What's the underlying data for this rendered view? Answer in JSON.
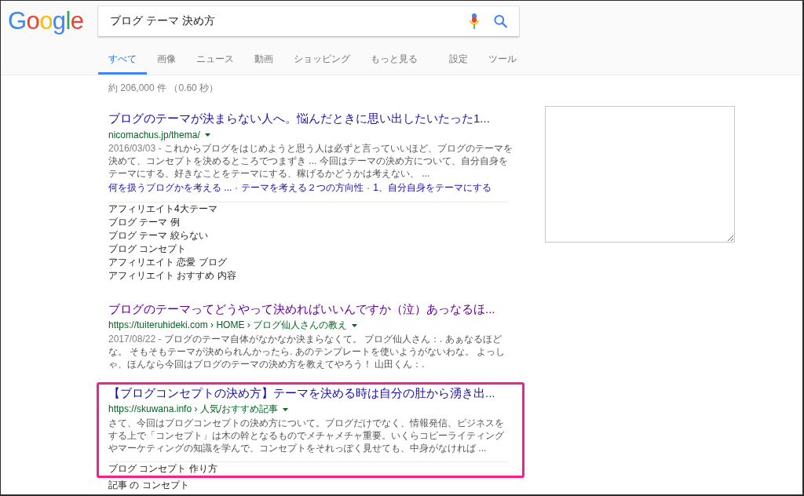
{
  "logo": "Google",
  "search": {
    "value": "ブログ テーマ 決め方"
  },
  "nav_tabs": [
    {
      "label": "すべて",
      "selected": true
    },
    {
      "label": "画像",
      "selected": false
    },
    {
      "label": "ニュース",
      "selected": false
    },
    {
      "label": "動画",
      "selected": false
    },
    {
      "label": "ショッピング",
      "selected": false
    },
    {
      "label": "もっと見る",
      "selected": false
    }
  ],
  "nav_tools": [
    {
      "label": "設定"
    },
    {
      "label": "ツール"
    }
  ],
  "result_stats": "約 206,000 件 （0.60 秒）",
  "results": [
    {
      "title": "ブログのテーマが決まらない人へ。悩んだときに思い出したいたった1...",
      "visited": false,
      "url": "nicomachus.jp/thema/",
      "date": "2016/03/03 -",
      "snippet": "これからブログをはじめようと思う人は必ずと言っていいほど、ブログのテーマを決めて、コンセプトを決めるところでつまずき ... 今回はテーマの決め方について、自分自身をテーマにする、好きなことをテーマにする、稼げるかどうかは考えない、 ...",
      "sitelinks": [
        "何を扱うブログかを考える ...",
        "テーマを考える２つの方向性",
        "1、自分自身をテーマにする"
      ],
      "highlighted": false,
      "related": [
        "アフィリエイト4大テーマ",
        "ブログ テーマ 例",
        "ブログ テーマ 絞らない",
        "ブログ コンセプト",
        "アフィリエイト 恋愛 ブログ",
        "アフィリエイト おすすめ 内容"
      ]
    },
    {
      "title": "ブログのテーマってどうやって決めればいいんですか（泣）あっなるほ...",
      "visited": true,
      "url": "https://tuiteruhideki.com › HOME › ブログ仙人さんの教え",
      "date": "2017/08/22 -",
      "snippet": "ブログのテーマ自体がなかなか決まらなくて。 ブログ仙人さん：. あぁなるほどな。 そもそもテーマが決められんかったら. あのテンプレートを使いようがないわな。 よっしゃ、ほんなら今回はブログのテーマの決め方を教えてやろう！ 山田くん：.",
      "highlighted": false
    },
    {
      "title": "【ブログコンセプトの決め方】テーマを決める時は自分の肚から湧き出...",
      "visited": false,
      "url": "https://skuwana.info › 人気/おすすめ記事",
      "snippet": "さて、今回はブログコンセプトの決め方について。ブログだけでなく、情報発信、ビジネスをする上で「コンセプト」は木の幹となるものでメチャメチャ重要。いくらコピーライティングやマーケティングの知識を学んで、コンセプトをそれっぽく見せても、中身がなければ ...",
      "highlighted": true,
      "related": [
        "ブログ コンセプト 作り方",
        "記事 の コンセプト"
      ]
    }
  ]
}
